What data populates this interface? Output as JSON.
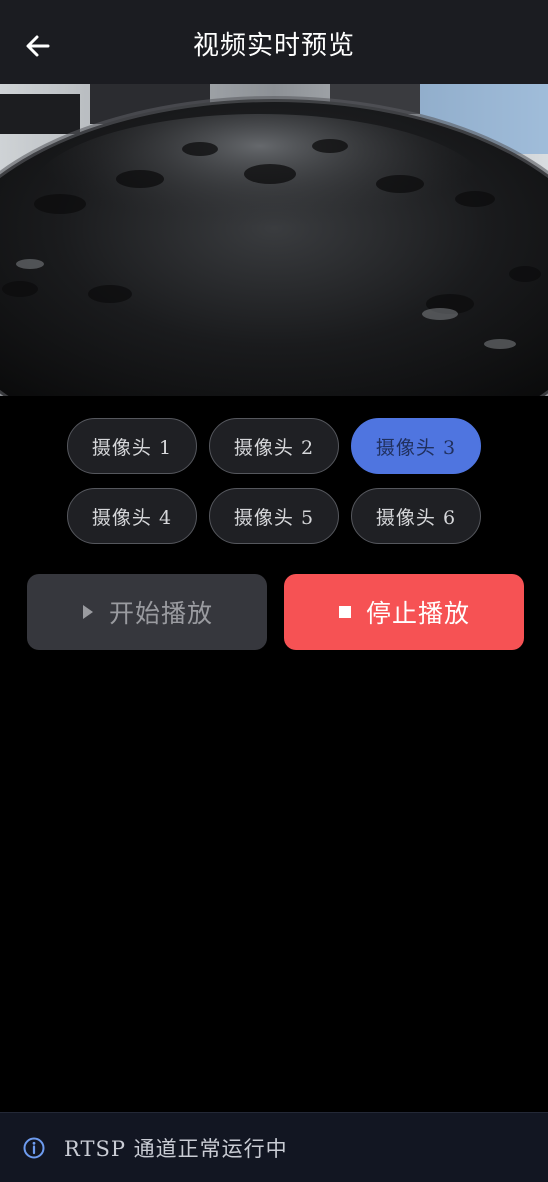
{
  "header": {
    "title": "视频实时预览",
    "back_icon": "arrow-left-icon"
  },
  "video": {
    "description_icon": "camera-feed"
  },
  "cameras": [
    {
      "label": "摄像头 1",
      "active": false
    },
    {
      "label": "摄像头 2",
      "active": false
    },
    {
      "label": "摄像头 3",
      "active": true
    },
    {
      "label": "摄像头 4",
      "active": false
    },
    {
      "label": "摄像头 5",
      "active": false
    },
    {
      "label": "摄像头 6",
      "active": false
    }
  ],
  "actions": {
    "start_label": "开始播放",
    "start_icon": "play-icon",
    "stop_label": "停止播放",
    "stop_icon": "stop-icon"
  },
  "status": {
    "icon": "info-icon",
    "text": "RTSP 通道正常运行中"
  },
  "colors": {
    "header_bg": "#1b1c21",
    "accent": "#4f75e0",
    "stop": "#f65254",
    "status_bg": "#121622"
  }
}
